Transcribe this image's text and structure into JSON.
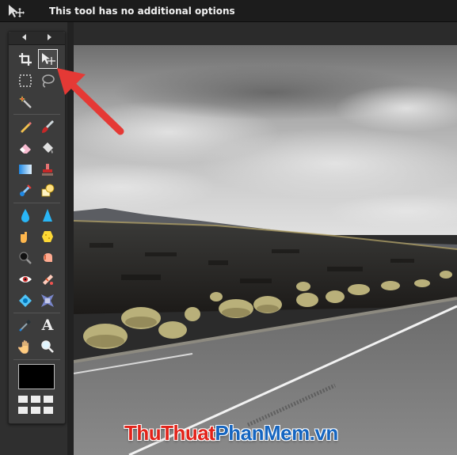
{
  "options_bar": {
    "tool_icon": "move-tool-icon",
    "message": "This tool has no additional options"
  },
  "tools_panel": {
    "nav": [
      "arrow-left-icon",
      "arrow-right-icon"
    ],
    "tools": [
      {
        "name": "crop",
        "icon": "crop-icon"
      },
      {
        "name": "move",
        "icon": "move-icon",
        "active": true
      },
      {
        "name": "marquee",
        "icon": "marquee-icon"
      },
      {
        "name": "lasso",
        "icon": "lasso-icon"
      },
      {
        "name": "magic-wand",
        "icon": "magic-wand-icon"
      },
      {
        "name": "pencil",
        "icon": "pencil-icon"
      },
      {
        "name": "brush",
        "icon": "brush-icon"
      },
      {
        "name": "eraser",
        "icon": "eraser-icon"
      },
      {
        "name": "bucket",
        "icon": "paint-bucket-icon"
      },
      {
        "name": "gradient",
        "icon": "gradient-icon"
      },
      {
        "name": "clone-stamp",
        "icon": "clone-stamp-icon"
      },
      {
        "name": "color-replace",
        "icon": "color-replace-icon"
      },
      {
        "name": "shapes",
        "icon": "shapes-icon"
      },
      {
        "name": "blur",
        "icon": "blur-icon"
      },
      {
        "name": "sharpen",
        "icon": "sharpen-icon"
      },
      {
        "name": "smudge",
        "icon": "smudge-icon"
      },
      {
        "name": "sponge",
        "icon": "sponge-icon"
      },
      {
        "name": "dodge",
        "icon": "dodge-icon"
      },
      {
        "name": "burn",
        "icon": "burn-icon"
      },
      {
        "name": "red-eye",
        "icon": "red-eye-icon"
      },
      {
        "name": "spot-heal",
        "icon": "spot-heal-icon"
      },
      {
        "name": "bloat",
        "icon": "bloat-icon"
      },
      {
        "name": "pinch",
        "icon": "pinch-icon"
      },
      {
        "name": "color-picker",
        "icon": "color-picker-icon"
      },
      {
        "name": "type",
        "icon": "type-icon",
        "glyph": "A"
      },
      {
        "name": "hand",
        "icon": "hand-icon"
      },
      {
        "name": "zoom",
        "icon": "zoom-icon"
      }
    ],
    "foreground_color": "#000000"
  },
  "canvas": {
    "image": "desert-road-landscape"
  },
  "annotation": {
    "arrow_color": "#e53935",
    "points_to": "move-tool"
  },
  "watermark": {
    "part1": "ThuThuat",
    "part2": "PhanMem",
    "part3": ".vn"
  }
}
